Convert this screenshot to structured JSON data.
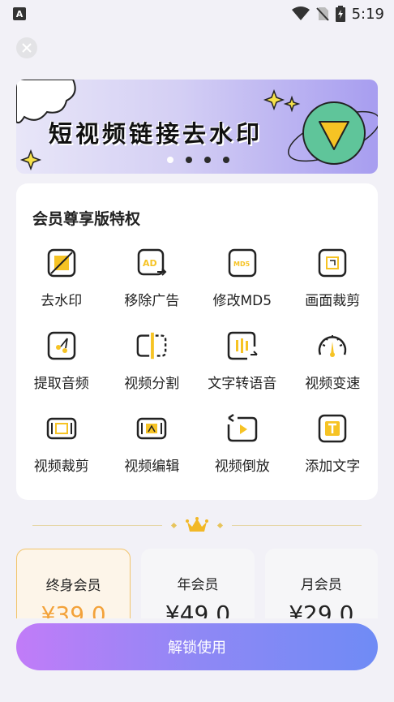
{
  "status_bar": {
    "time": "5:19",
    "notification_icon": "A"
  },
  "banner": {
    "title": "短视频链接去水印",
    "dot_count": 4,
    "active_dot": 0
  },
  "privileges": {
    "title": "会员尊享版特权",
    "items": [
      {
        "label": "去水印",
        "icon": "watermark-remove-icon"
      },
      {
        "label": "移除广告",
        "icon": "ad-remove-icon"
      },
      {
        "label": "修改MD5",
        "icon": "md5-icon"
      },
      {
        "label": "画面裁剪",
        "icon": "crop-icon"
      },
      {
        "label": "提取音频",
        "icon": "audio-extract-icon"
      },
      {
        "label": "视频分割",
        "icon": "video-split-icon"
      },
      {
        "label": "文字转语音",
        "icon": "text-to-speech-icon"
      },
      {
        "label": "视频变速",
        "icon": "speedometer-icon"
      },
      {
        "label": "视频裁剪",
        "icon": "video-crop-icon"
      },
      {
        "label": "视频编辑",
        "icon": "video-edit-icon"
      },
      {
        "label": "视频倒放",
        "icon": "video-reverse-icon"
      },
      {
        "label": "添加文字",
        "icon": "add-text-icon"
      }
    ]
  },
  "plans": [
    {
      "name": "终身会员",
      "price": "¥39.0",
      "selected": true
    },
    {
      "name": "年会员",
      "price": "¥49.0",
      "selected": false
    },
    {
      "name": "月会员",
      "price": "¥29.0",
      "selected": false
    }
  ],
  "unlock_button": {
    "label": "解锁使用"
  },
  "colors": {
    "accent": "#f3a23a",
    "icon_yellow": "#f6c324",
    "button_start": "#c17cf8",
    "button_end": "#6f8bf5"
  }
}
